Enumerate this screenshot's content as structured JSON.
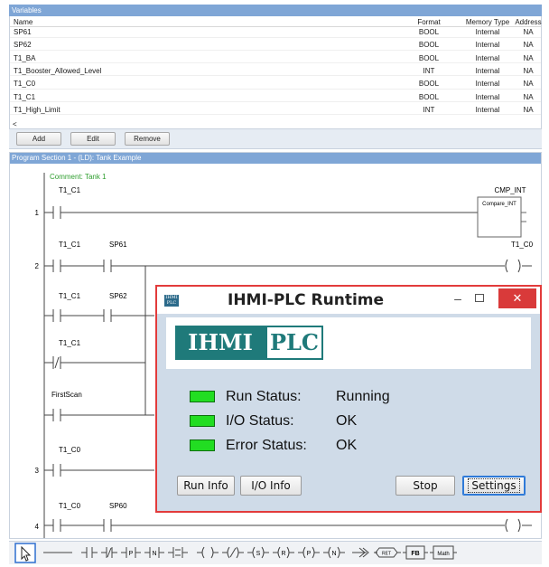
{
  "variables_panel": {
    "title": "Variables",
    "columns": {
      "name": "Name",
      "format": "Format",
      "memory_type": "Memory Type",
      "address": "Address"
    },
    "rows": [
      {
        "name": "SP61",
        "format": "BOOL",
        "memory_type": "Internal",
        "address": "NA"
      },
      {
        "name": "SP62",
        "format": "BOOL",
        "memory_type": "Internal",
        "address": "NA"
      },
      {
        "name": "T1_BA",
        "format": "BOOL",
        "memory_type": "Internal",
        "address": "NA"
      },
      {
        "name": "T1_Booster_Allowed_Level",
        "format": "INT",
        "memory_type": "Internal",
        "address": "NA"
      },
      {
        "name": "T1_C0",
        "format": "BOOL",
        "memory_type": "Internal",
        "address": "NA"
      },
      {
        "name": "T1_C1",
        "format": "BOOL",
        "memory_type": "Internal",
        "address": "NA"
      },
      {
        "name": "T1_High_Limit",
        "format": "INT",
        "memory_type": "Internal",
        "address": "NA"
      }
    ],
    "scroll_glyph": "<"
  },
  "variable_buttons": {
    "add": "Add",
    "edit": "Edit",
    "remove": "Remove"
  },
  "program_panel": {
    "title": "Program Section 1 - (LD): Tank Example",
    "comment": "Comment: Tank 1",
    "rungs": [
      {
        "number": "1",
        "contacts": [
          "T1_C1"
        ],
        "block_label": "CMP_INT",
        "block_name": "Compare_INT"
      },
      {
        "number": "2",
        "contacts": [
          "T1_C1",
          "SP61"
        ],
        "coil": "T1_C0"
      },
      {
        "number": "",
        "contacts": [
          "T1_C1",
          "SP62"
        ]
      },
      {
        "number": "",
        "contacts": [
          "T1_C1"
        ]
      },
      {
        "number": "",
        "contacts": [
          "FirstScan"
        ]
      },
      {
        "number": "3",
        "contacts": [
          "T1_C0"
        ]
      },
      {
        "number": "4",
        "contacts": [
          "T1_C0",
          "SP60"
        ]
      }
    ]
  },
  "toolbar": {
    "items": [
      "select-pointer",
      "horizontal-wire",
      "no-contact",
      "nc-contact",
      "positive-transition-contact",
      "negative-transition-contact",
      "compare-contact",
      "coil",
      "negated-coil",
      "set-coil",
      "reset-coil",
      "positive-coil",
      "negative-coil",
      "jump",
      "return",
      "function-block",
      "math-block"
    ],
    "labels": {
      "p": "P",
      "n": "N",
      "s": "S",
      "r": "R",
      "p2": "P",
      "n2": "N",
      "ret": "RET",
      "fb": "FB",
      "math": "Math"
    }
  },
  "runtime_window": {
    "icon_text": "IHMI PLC",
    "title": "IHMI-PLC Runtime",
    "logo_left": "IHMI",
    "logo_right": "PLC",
    "statuses": [
      {
        "label": "Run Status:",
        "value": "Running",
        "color": "#22dd22"
      },
      {
        "label": "I/O Status:",
        "value": "OK",
        "color": "#22dd22"
      },
      {
        "label": "Error Status:",
        "value": "OK",
        "color": "#22dd22"
      }
    ],
    "buttons": {
      "run_info": "Run Info",
      "io_info": "I/O Info",
      "stop": "Stop",
      "settings": "Settings"
    },
    "close_glyph": "✕",
    "minimize_glyph": "–"
  },
  "colors": {
    "accent_red": "#e23b3b",
    "led_green": "#22dd22",
    "title_blue": "#7fa6d6",
    "logo_teal": "#1f7a7a"
  }
}
